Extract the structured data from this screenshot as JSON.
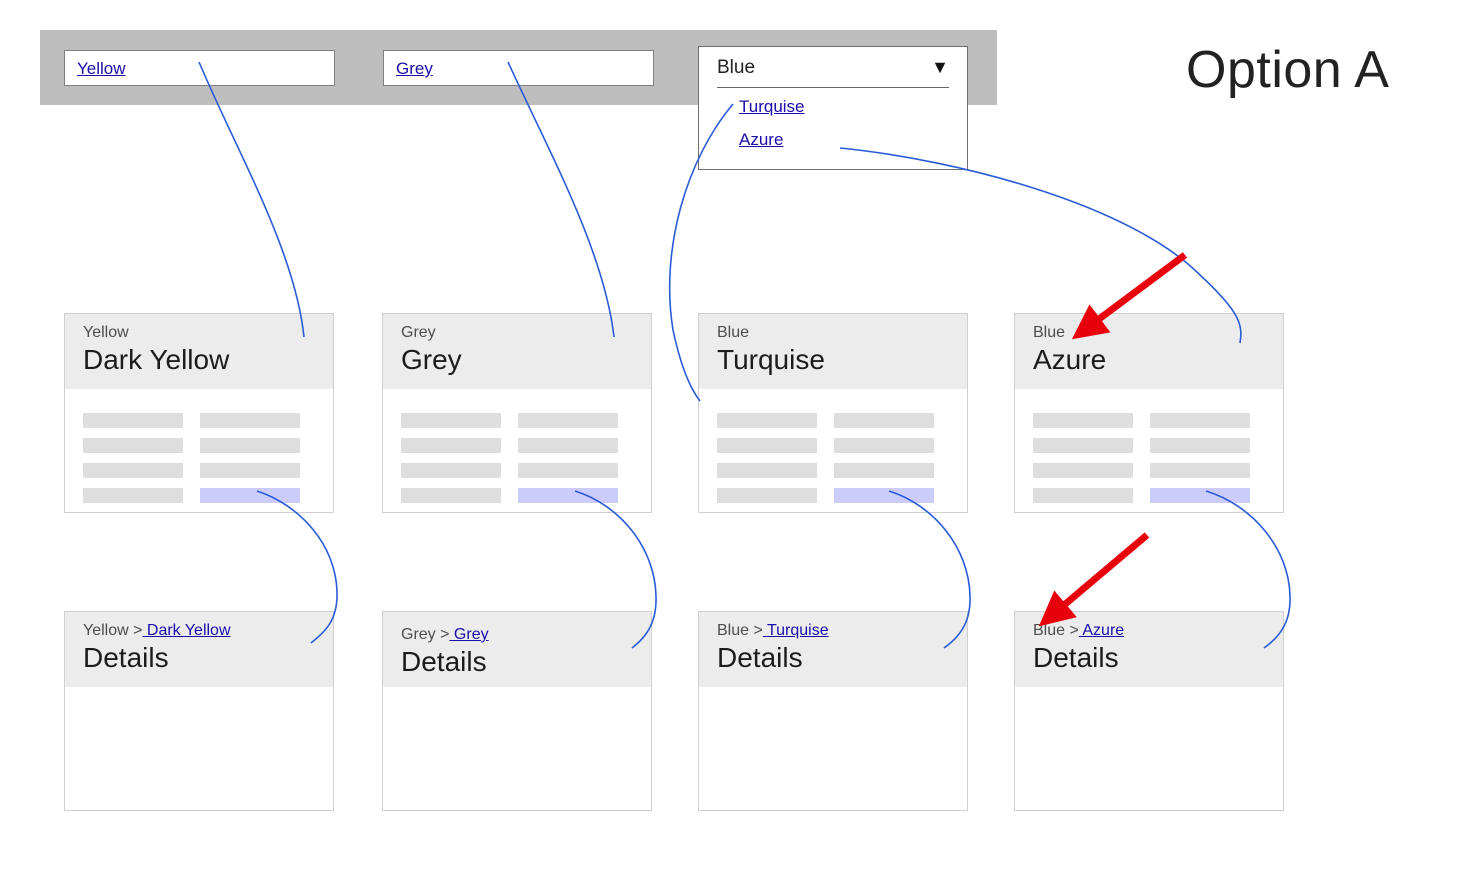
{
  "option_title": "Option A",
  "toolbar": {
    "nav_links": [
      {
        "label": "Yellow",
        "name": "nav-link-yellow"
      },
      {
        "label": "Grey",
        "name": "nav-link-grey"
      }
    ],
    "dropdown": {
      "selected": "Blue",
      "caret_icon": "chevron-down-icon",
      "caret_glyph": "▼",
      "options": [
        {
          "label": "Turquise"
        },
        {
          "label": "Azure"
        }
      ]
    }
  },
  "colors": {
    "toolbar_bg": "#bebebe",
    "card_header_bg": "#ececec",
    "card_border": "#cfcfcf",
    "placeholder_bar": "#dedede",
    "accent_bar": "#ccccfa",
    "link": "#1a0dab",
    "annotation_line": "#2a5bd7",
    "annotation_arrow": "#e8000d"
  },
  "cards": [
    {
      "eyebrow": "Yellow",
      "title": "Dark Yellow"
    },
    {
      "eyebrow": "Grey",
      "title": "Grey"
    },
    {
      "eyebrow": "Blue",
      "title": "Turquise"
    },
    {
      "eyebrow": "Blue",
      "title": "Azure"
    }
  ],
  "details_cards": [
    {
      "crumb_root": "Yellow >",
      "crumb_leaf": " Dark Yellow",
      "title": "Details"
    },
    {
      "crumb_root": "Grey >",
      "crumb_leaf": " Grey",
      "title": "Details"
    },
    {
      "crumb_root": "Blue >",
      "crumb_leaf": " Turquise",
      "title": "Details"
    },
    {
      "crumb_root": "Blue >",
      "crumb_leaf": " Azure",
      "title": "Details"
    }
  ]
}
